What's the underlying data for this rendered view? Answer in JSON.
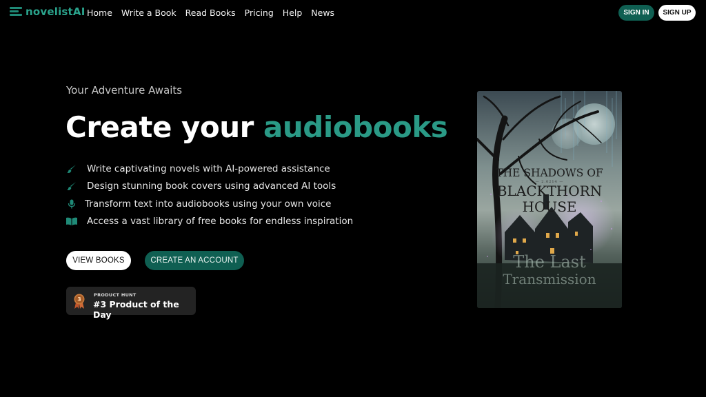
{
  "brand": {
    "name": "novelistAI",
    "accent": "#2aa38c"
  },
  "nav": {
    "links": [
      "Home",
      "Write a Book",
      "Read Books",
      "Pricing",
      "Help",
      "News"
    ],
    "sign_in": "SIGN IN",
    "sign_up": "SIGN UP"
  },
  "hero": {
    "eyebrow": "Your Adventure Awaits",
    "headline_plain": "Create your ",
    "headline_accent": "audiobooks",
    "features": [
      {
        "icon": "brush-icon",
        "text": "Write captivating novels with AI-powered assistance"
      },
      {
        "icon": "brush-icon",
        "text": "Design stunning book covers using advanced AI tools"
      },
      {
        "icon": "microphone-icon",
        "text": "Transform text into audiobooks using your own voice"
      },
      {
        "icon": "open-book-icon",
        "text": "Access a vast library of free books for endless inspiration"
      }
    ],
    "view_books": "VIEW BOOKS",
    "create_account": "CREATE AN ACCOUNT"
  },
  "product_hunt": {
    "label": "PRODUCT HUNT",
    "rank": "3",
    "title": "#3 Product of the Day"
  },
  "cover": {
    "title_line1": "THE SHADOWS OF",
    "subtitle": "— 2.0214 —",
    "title_line2": "BLACKTHORN",
    "title_line3": "HOUSE",
    "overlay_line1": "The Last",
    "overlay_line2": "Transmission"
  }
}
